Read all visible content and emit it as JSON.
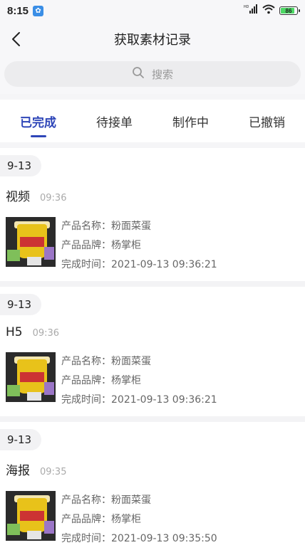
{
  "status_bar": {
    "time": "8:15",
    "battery": "86",
    "battery_level": 0.86,
    "network": "HD"
  },
  "header": {
    "title": "获取素材记录"
  },
  "search": {
    "placeholder": "搜索"
  },
  "tabs": [
    {
      "label": "已完成",
      "active": true
    },
    {
      "label": "待接单",
      "active": false
    },
    {
      "label": "制作中",
      "active": false
    },
    {
      "label": "已撤销",
      "active": false
    }
  ],
  "records": [
    {
      "date": "9-13",
      "type": "视频",
      "time": "09:36",
      "product_name_line": "产品名称：粉面菜蛋",
      "product_brand_line": "产品品牌：杨掌柜",
      "complete_time_line": "完成时间：2021-09-13 09:36:21"
    },
    {
      "date": "9-13",
      "type": "H5",
      "time": "09:36",
      "product_name_line": "产品名称：粉面菜蛋",
      "product_brand_line": "产品品牌：杨掌柜",
      "complete_time_line": "完成时间：2021-09-13 09:36:21"
    },
    {
      "date": "9-13",
      "type": "海报",
      "time": "09:35",
      "product_name_line": "产品名称：粉面菜蛋",
      "product_brand_line": "产品品牌：杨掌柜",
      "complete_time_line": "完成时间：2021-09-13 09:35:50"
    }
  ],
  "colors": {
    "accent": "#2e46b8",
    "background": "#f5f5f7"
  }
}
